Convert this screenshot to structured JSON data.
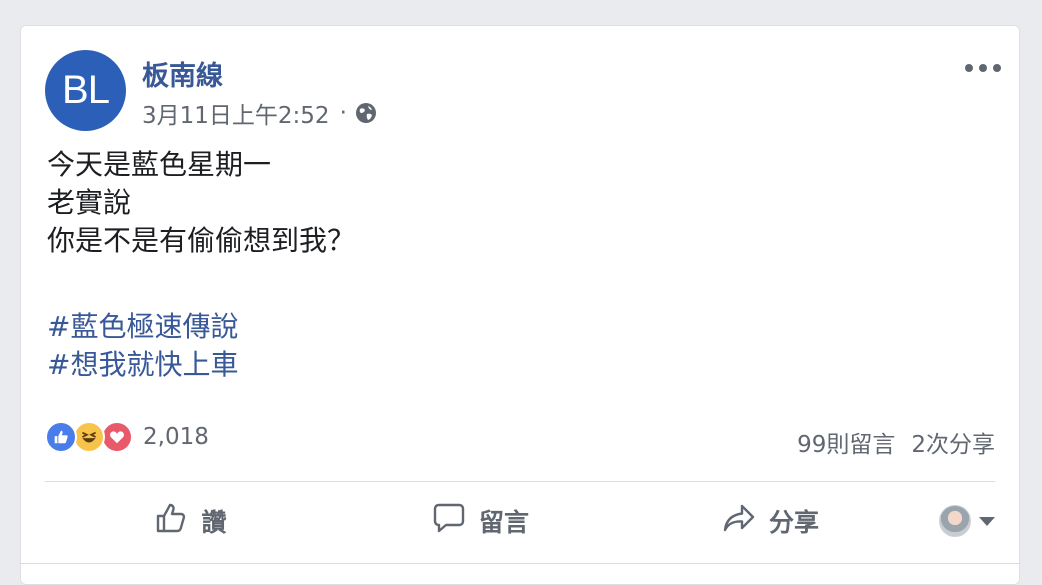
{
  "post": {
    "avatar_text": "BL",
    "author": "板南線",
    "timestamp": "3月11日上午2:52",
    "separator": "·",
    "privacy_icon": "globe-icon",
    "more_icon": "more-options-icon",
    "lines": [
      "今天是藍色星期一",
      "老實說",
      "你是不是有偷偷想到我？"
    ],
    "hashtags": [
      "#藍色極速傳說",
      "#想我就快上車"
    ]
  },
  "engagement": {
    "reaction_icons": [
      "like-icon",
      "haha-icon",
      "love-icon"
    ],
    "reaction_count": "2,018",
    "comments": "99則留言",
    "shares": "2次分享"
  },
  "actions": {
    "like_label": "讚",
    "comment_label": "留言",
    "share_label": "分享"
  },
  "colors": {
    "brand_blue": "#385898",
    "avatar_bg": "#2c5fb7",
    "text": "#1c1e21",
    "secondary": "#606770",
    "like": "#4a7dea",
    "haha": "#f7c34b",
    "love": "#e85a6a"
  }
}
